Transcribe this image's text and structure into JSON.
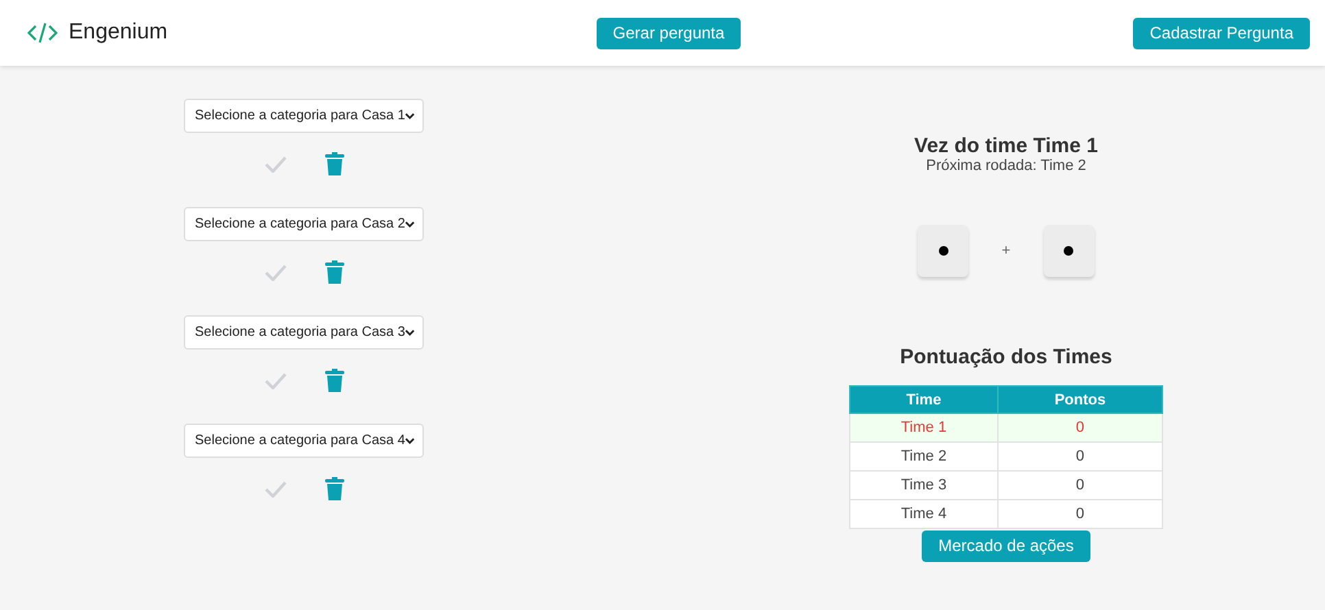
{
  "header": {
    "logo_text": "Engenium",
    "buttons": [
      {
        "label": "Gerar pergunta"
      },
      {
        "label": "Cadastrar Pergunta"
      }
    ]
  },
  "houses": [
    {
      "placeholder": "Selecione a categoria para Casa 1",
      "confirm_disabled": true
    },
    {
      "placeholder": "Selecione a categoria para Casa 2",
      "confirm_disabled": true
    },
    {
      "placeholder": "Selecione a categoria para Casa 3",
      "confirm_disabled": true
    },
    {
      "placeholder": "Selecione a categoria para Casa 4",
      "confirm_disabled": true
    }
  ],
  "turn": {
    "title": "Vez do time Time 1",
    "next": "Próxima rodada: Time 2"
  },
  "dice": [
    {
      "kind": "die"
    },
    {
      "kind": "die"
    }
  ],
  "dice_operator": "+",
  "scores": {
    "title": "Pontuação dos Times",
    "columns": [
      "Time",
      "Pontos"
    ],
    "rows": [
      {
        "team": "Time 1",
        "points": "0",
        "selected": true
      },
      {
        "team": "Time 2",
        "points": "0",
        "selected": false
      },
      {
        "team": "Time 3",
        "points": "0",
        "selected": false
      },
      {
        "team": "Time 4",
        "points": "0",
        "selected": false
      }
    ],
    "button": "Mercado de ações"
  }
}
